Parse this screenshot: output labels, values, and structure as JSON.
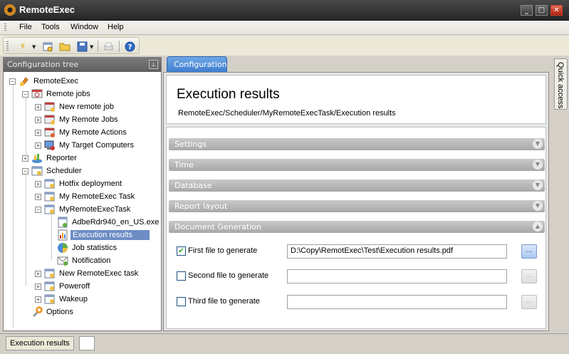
{
  "window": {
    "title": "RemoteExec"
  },
  "menu": {
    "items": [
      "File",
      "Tools",
      "Window",
      "Help"
    ]
  },
  "toolbar": {
    "buttons": [
      "run-icon",
      "new-task-icon",
      "open-folder-icon",
      "save-icon",
      "print-icon",
      "help-icon"
    ]
  },
  "left_panel": {
    "title": "Configuration tree",
    "tree": [
      {
        "label": "RemoteExec"
      },
      {
        "label": "Remote jobs"
      },
      {
        "label": "New remote job"
      },
      {
        "label": "My Remote Jobs"
      },
      {
        "label": "My Remote Actions"
      },
      {
        "label": "My Target Computers"
      },
      {
        "label": "Reporter"
      },
      {
        "label": "Scheduler"
      },
      {
        "label": "Hotfix deployment"
      },
      {
        "label": "My RemoteExec Task"
      },
      {
        "label": "MyRemoteExecTask"
      },
      {
        "label": "AdbeRdr940_en_US.exe"
      },
      {
        "label": "Execution results"
      },
      {
        "label": "Job statistics"
      },
      {
        "label": "Notification"
      },
      {
        "label": "New RemoteExec task"
      },
      {
        "label": "Poweroff"
      },
      {
        "label": "Wakeup"
      },
      {
        "label": "Options"
      }
    ]
  },
  "main": {
    "tab": "Configuration",
    "title": "Execution results",
    "path": "RemoteExec/Scheduler/MyRemoteExecTask/Execution results",
    "sections": [
      "Settings",
      "Time",
      "Database",
      "Report layout",
      "Document Generation"
    ],
    "files": [
      {
        "label": "First file to generate",
        "checked": true,
        "value": "D:\\Copy\\RemotExec\\Test\\Execution results.pdf",
        "browse": "..."
      },
      {
        "label": "Second file to generate",
        "checked": false,
        "value": "",
        "browse": "..."
      },
      {
        "label": "Third file to generate",
        "checked": false,
        "value": "",
        "browse": "..."
      }
    ]
  },
  "quick_access": "Quick access",
  "status": {
    "text": "Execution results"
  },
  "colors": {
    "tab": "#4a8ad8",
    "selection": "#6d8dc4",
    "section_header": "#b8b8b8",
    "titlebar": "#333333"
  }
}
